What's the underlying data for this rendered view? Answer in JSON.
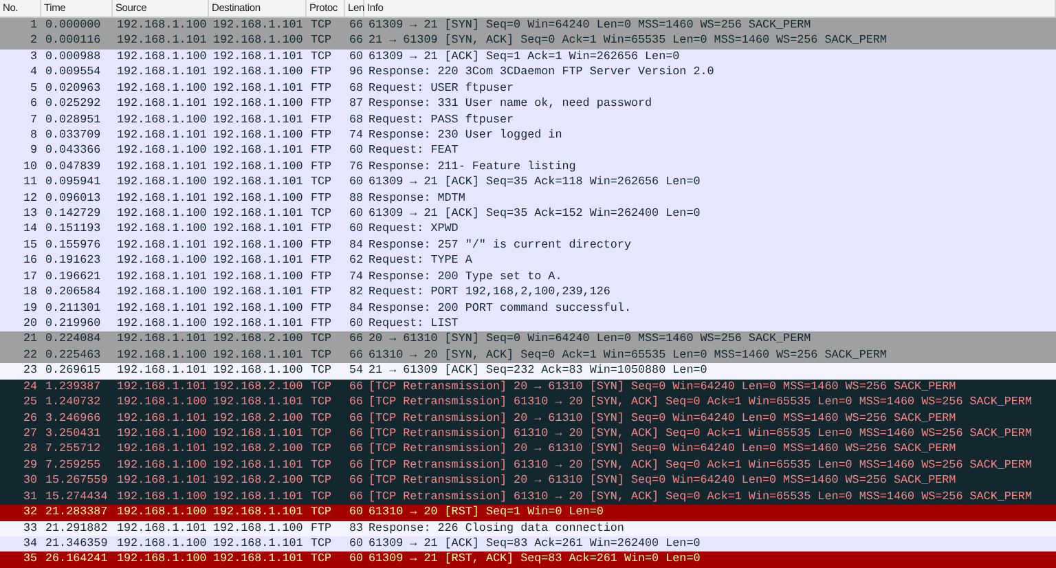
{
  "table": {
    "columns": [
      "No.",
      "Time",
      "Source",
      "Destination",
      "Protoc",
      "Len",
      "Info"
    ],
    "rows": [
      {
        "kind": "syn",
        "cells": [
          "1",
          "0.000000",
          "192.168.1.100",
          "192.168.1.101",
          "TCP",
          "66",
          "61309 → 21 [SYN] Seq=0 Win=64240 Len=0 MSS=1460 WS=256 SACK_PERM"
        ]
      },
      {
        "kind": "syn",
        "cells": [
          "2",
          "0.000116",
          "192.168.1.101",
          "192.168.1.100",
          "TCP",
          "66",
          "21 → 61309 [SYN, ACK] Seq=0 Ack=1 Win=65535 Len=0 MSS=1460 WS=256 SACK_PERM"
        ]
      },
      {
        "kind": "tcp",
        "cells": [
          "3",
          "0.000988",
          "192.168.1.100",
          "192.168.1.101",
          "TCP",
          "60",
          "61309 → 21 [ACK] Seq=1 Ack=1 Win=262656 Len=0"
        ]
      },
      {
        "kind": "tcp",
        "cells": [
          "4",
          "0.009554",
          "192.168.1.101",
          "192.168.1.100",
          "FTP",
          "96",
          "Response: 220 3Com 3CDaemon FTP Server Version 2.0"
        ]
      },
      {
        "kind": "tcp",
        "cells": [
          "5",
          "0.020963",
          "192.168.1.100",
          "192.168.1.101",
          "FTP",
          "68",
          "Request: USER ftpuser"
        ]
      },
      {
        "kind": "tcp",
        "cells": [
          "6",
          "0.025292",
          "192.168.1.101",
          "192.168.1.100",
          "FTP",
          "87",
          "Response: 331 User name ok, need password"
        ]
      },
      {
        "kind": "tcp",
        "cells": [
          "7",
          "0.028951",
          "192.168.1.100",
          "192.168.1.101",
          "FTP",
          "68",
          "Request: PASS ftpuser"
        ]
      },
      {
        "kind": "tcp",
        "cells": [
          "8",
          "0.033709",
          "192.168.1.101",
          "192.168.1.100",
          "FTP",
          "74",
          "Response: 230 User logged in"
        ]
      },
      {
        "kind": "tcp",
        "cells": [
          "9",
          "0.043366",
          "192.168.1.100",
          "192.168.1.101",
          "FTP",
          "60",
          "Request: FEAT"
        ]
      },
      {
        "kind": "tcp",
        "cells": [
          "10",
          "0.047839",
          "192.168.1.101",
          "192.168.1.100",
          "FTP",
          "76",
          "Response: 211- Feature listing"
        ]
      },
      {
        "kind": "tcp",
        "cells": [
          "11",
          "0.095941",
          "192.168.1.100",
          "192.168.1.101",
          "TCP",
          "60",
          "61309 → 21 [ACK] Seq=35 Ack=118 Win=262656 Len=0"
        ]
      },
      {
        "kind": "tcp",
        "cells": [
          "12",
          "0.096013",
          "192.168.1.101",
          "192.168.1.100",
          "FTP",
          "88",
          "Response: MDTM"
        ]
      },
      {
        "kind": "tcp",
        "cells": [
          "13",
          "0.142729",
          "192.168.1.100",
          "192.168.1.101",
          "TCP",
          "60",
          "61309 → 21 [ACK] Seq=35 Ack=152 Win=262400 Len=0"
        ]
      },
      {
        "kind": "tcp",
        "cells": [
          "14",
          "0.151193",
          "192.168.1.100",
          "192.168.1.101",
          "FTP",
          "60",
          "Request: XPWD"
        ]
      },
      {
        "kind": "tcp",
        "cells": [
          "15",
          "0.155976",
          "192.168.1.101",
          "192.168.1.100",
          "FTP",
          "84",
          "Response: 257 \"/\" is current directory"
        ]
      },
      {
        "kind": "tcp",
        "cells": [
          "16",
          "0.191623",
          "192.168.1.100",
          "192.168.1.101",
          "FTP",
          "62",
          "Request: TYPE A"
        ]
      },
      {
        "kind": "tcp",
        "cells": [
          "17",
          "0.196621",
          "192.168.1.101",
          "192.168.1.100",
          "FTP",
          "74",
          "Response: 200 Type set to A."
        ]
      },
      {
        "kind": "tcp",
        "cells": [
          "18",
          "0.206584",
          "192.168.1.100",
          "192.168.1.101",
          "FTP",
          "82",
          "Request: PORT 192,168,2,100,239,126"
        ]
      },
      {
        "kind": "tcp",
        "cells": [
          "19",
          "0.211301",
          "192.168.1.101",
          "192.168.1.100",
          "FTP",
          "84",
          "Response: 200 PORT command successful."
        ]
      },
      {
        "kind": "tcp",
        "cells": [
          "20",
          "0.219960",
          "192.168.1.100",
          "192.168.1.101",
          "FTP",
          "60",
          "Request: LIST"
        ]
      },
      {
        "kind": "syn",
        "cells": [
          "21",
          "0.224084",
          "192.168.1.101",
          "192.168.2.100",
          "TCP",
          "66",
          "20 → 61310 [SYN] Seq=0 Win=64240 Len=0 MSS=1460 WS=256 SACK_PERM"
        ]
      },
      {
        "kind": "syn",
        "cells": [
          "22",
          "0.225463",
          "192.168.1.100",
          "192.168.1.101",
          "TCP",
          "66",
          "61310 → 20 [SYN, ACK] Seq=0 Ack=1 Win=65535 Len=0 MSS=1460 WS=256 SACK_PERM"
        ]
      },
      {
        "kind": "plain",
        "cells": [
          "23",
          "0.269615",
          "192.168.1.101",
          "192.168.1.100",
          "TCP",
          "54",
          "21 → 61309 [ACK] Seq=232 Ack=83 Win=1050880 Len=0"
        ]
      },
      {
        "kind": "retransmission",
        "cells": [
          "24",
          "1.239387",
          "192.168.1.101",
          "192.168.2.100",
          "TCP",
          "66",
          "[TCP Retransmission] 20 → 61310 [SYN] Seq=0 Win=64240 Len=0 MSS=1460 WS=256 SACK_PERM"
        ]
      },
      {
        "kind": "retransmission",
        "cells": [
          "25",
          "1.240732",
          "192.168.1.100",
          "192.168.1.101",
          "TCP",
          "66",
          "[TCP Retransmission] 61310 → 20 [SYN, ACK] Seq=0 Ack=1 Win=65535 Len=0 MSS=1460 WS=256 SACK_PERM"
        ]
      },
      {
        "kind": "retransmission",
        "cells": [
          "26",
          "3.246966",
          "192.168.1.101",
          "192.168.2.100",
          "TCP",
          "66",
          "[TCP Retransmission] 20 → 61310 [SYN] Seq=0 Win=64240 Len=0 MSS=1460 WS=256 SACK_PERM"
        ]
      },
      {
        "kind": "retransmission",
        "cells": [
          "27",
          "3.250431",
          "192.168.1.100",
          "192.168.1.101",
          "TCP",
          "66",
          "[TCP Retransmission] 61310 → 20 [SYN, ACK] Seq=0 Ack=1 Win=65535 Len=0 MSS=1460 WS=256 SACK_PERM"
        ]
      },
      {
        "kind": "retransmission",
        "cells": [
          "28",
          "7.255712",
          "192.168.1.101",
          "192.168.2.100",
          "TCP",
          "66",
          "[TCP Retransmission] 20 → 61310 [SYN] Seq=0 Win=64240 Len=0 MSS=1460 WS=256 SACK_PERM"
        ]
      },
      {
        "kind": "retransmission",
        "cells": [
          "29",
          "7.259255",
          "192.168.1.100",
          "192.168.1.101",
          "TCP",
          "66",
          "[TCP Retransmission] 61310 → 20 [SYN, ACK] Seq=0 Ack=1 Win=65535 Len=0 MSS=1460 WS=256 SACK_PERM"
        ]
      },
      {
        "kind": "retransmission",
        "cells": [
          "30",
          "15.267559",
          "192.168.1.101",
          "192.168.2.100",
          "TCP",
          "66",
          "[TCP Retransmission] 20 → 61310 [SYN] Seq=0 Win=64240 Len=0 MSS=1460 WS=256 SACK_PERM"
        ]
      },
      {
        "kind": "retransmission",
        "cells": [
          "31",
          "15.274434",
          "192.168.1.100",
          "192.168.1.101",
          "TCP",
          "66",
          "[TCP Retransmission] 61310 → 20 [SYN, ACK] Seq=0 Ack=1 Win=65535 Len=0 MSS=1460 WS=256 SACK_PERM"
        ]
      },
      {
        "kind": "rst",
        "cells": [
          "32",
          "21.283387",
          "192.168.1.100",
          "192.168.1.101",
          "TCP",
          "60",
          "61310 → 20 [RST] Seq=1 Win=0 Len=0"
        ]
      },
      {
        "kind": "plain",
        "cells": [
          "33",
          "21.291882",
          "192.168.1.101",
          "192.168.1.100",
          "FTP",
          "83",
          "Response: 226 Closing data connection"
        ]
      },
      {
        "kind": "tcp",
        "cells": [
          "34",
          "21.346359",
          "192.168.1.100",
          "192.168.1.101",
          "TCP",
          "60",
          "61309 → 21 [ACK] Seq=83 Ack=261 Win=262400 Len=0"
        ]
      },
      {
        "kind": "rst",
        "cells": [
          "35",
          "26.164241",
          "192.168.1.100",
          "192.168.1.101",
          "TCP",
          "60",
          "61309 → 21 [RST, ACK] Seq=83 Ack=261 Win=0 Len=0"
        ]
      }
    ]
  }
}
